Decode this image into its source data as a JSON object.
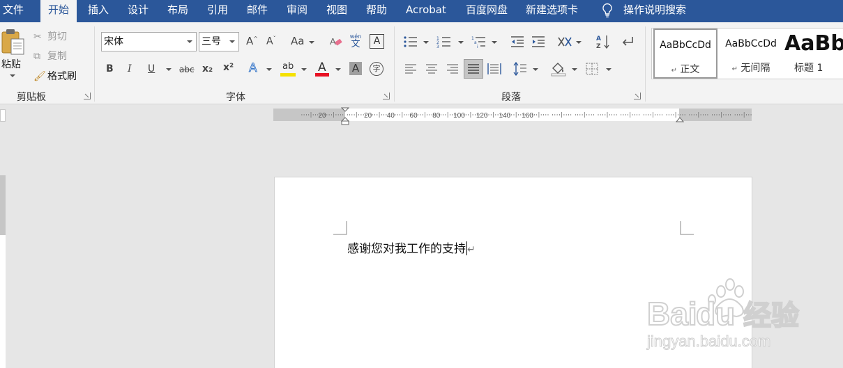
{
  "tabs": [
    "文件",
    "开始",
    "插入",
    "设计",
    "布局",
    "引用",
    "邮件",
    "审阅",
    "视图",
    "帮助",
    "Acrobat",
    "百度网盘",
    "新建选项卡"
  ],
  "tell_me": "操作说明搜索",
  "clipboard": {
    "paste": "粘贴",
    "cut": "剪切",
    "copy": "复制",
    "format_painter": "格式刷",
    "group_label": "剪贴板"
  },
  "font": {
    "family": "宋体",
    "size": "三号",
    "group_label": "字体",
    "phonetic_top": "wén",
    "phonetic_bottom": "文",
    "bold": "B",
    "italic": "I",
    "underline": "U",
    "strikethrough": "abc",
    "subscript": "x₂",
    "superscript": "x²",
    "grow": "A",
    "shrink": "A",
    "change_case": "Aa",
    "clear_format": "A",
    "font_color": "A",
    "char_shading": "A",
    "enclose": "字",
    "highlight_color": "#f5e100",
    "font_color_value": "#e81123"
  },
  "paragraph": {
    "group_label": "段落"
  },
  "styles": [
    {
      "sample": "AaBbCcDd",
      "name": "正文",
      "mark": "↵"
    },
    {
      "sample": "AaBbCcDd",
      "name": "无间隔",
      "mark": "↵"
    },
    {
      "sample": "AaBb",
      "name": "标题 1"
    }
  ],
  "ruler": {
    "labels": [
      "20",
      "20",
      "40",
      "60",
      "80",
      "100",
      "120",
      "140",
      "160"
    ]
  },
  "document": {
    "text": "感谢您对我工作的支持",
    "para_mark": "↵"
  },
  "watermark": {
    "brand": "Bai",
    "brand_suffix": "du",
    "jingyan": "经验",
    "url": "jingyan.baidu.com"
  },
  "colors": {
    "ribbon_blue": "#2b579a",
    "ribbon_bg": "#f3f3f3",
    "workspace": "#e6e6e6"
  }
}
